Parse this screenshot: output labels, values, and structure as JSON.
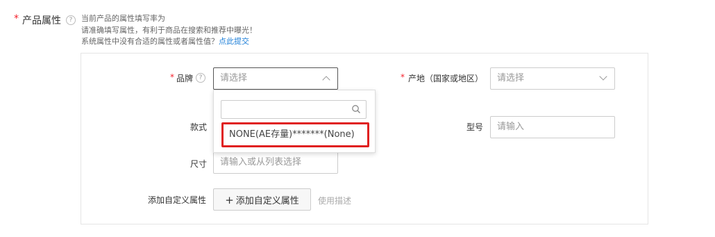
{
  "section": {
    "required_mark": "*",
    "label": "产品属性",
    "help_icon": "question-circle-icon",
    "tip_line1": "当前产品的属性填写率为",
    "tip_line2": "请准确填写属性，有利于商品在搜索和推荐中曝光！",
    "tip_line3": "系统属性中没有合适的属性或者属性值？",
    "tip_link": "点此提交"
  },
  "fields": {
    "brand": {
      "required_mark": "*",
      "label": "品牌",
      "placeholder": "请选择"
    },
    "origin": {
      "required_mark": "*",
      "label": "产地（国家或地区）",
      "placeholder": "请选择"
    },
    "style": {
      "label": "款式"
    },
    "model": {
      "label": "型号",
      "placeholder": "请输入"
    },
    "size": {
      "label": "尺寸",
      "placeholder": "请输入或从列表选择"
    },
    "custom": {
      "label": "添加自定义属性",
      "button_label": "添加自定义属性",
      "usage_link": "使用描述"
    }
  },
  "dropdown": {
    "search_value": "",
    "options": [
      "NONE(AE存量)*******(None)"
    ]
  },
  "colors": {
    "required": "#f5222d",
    "link": "#1e7fd8",
    "highlight_border": "#e02020"
  }
}
